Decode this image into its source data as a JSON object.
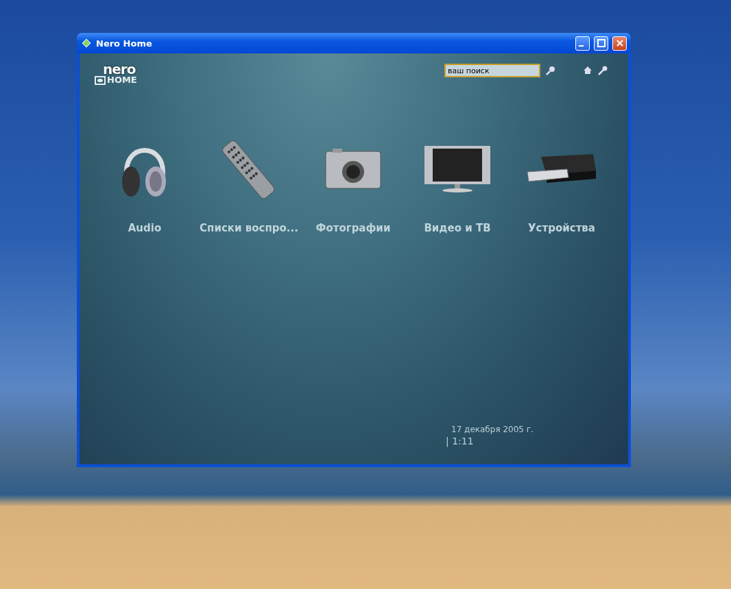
{
  "window": {
    "title": "Nero Home"
  },
  "logo": {
    "top": "nero",
    "bottom": "HOME"
  },
  "search": {
    "value": "ваш поиск"
  },
  "menu": [
    {
      "kind": "headphones",
      "label": "Audio"
    },
    {
      "kind": "remote",
      "label": "Списки воспро..."
    },
    {
      "kind": "camera",
      "label": "Фотографии"
    },
    {
      "kind": "tv",
      "label": "Видео и ТВ"
    },
    {
      "kind": "drive",
      "label": "Устройства"
    }
  ],
  "clock": {
    "date": "17 декабря 2005 г.",
    "time": "| 1:11"
  }
}
